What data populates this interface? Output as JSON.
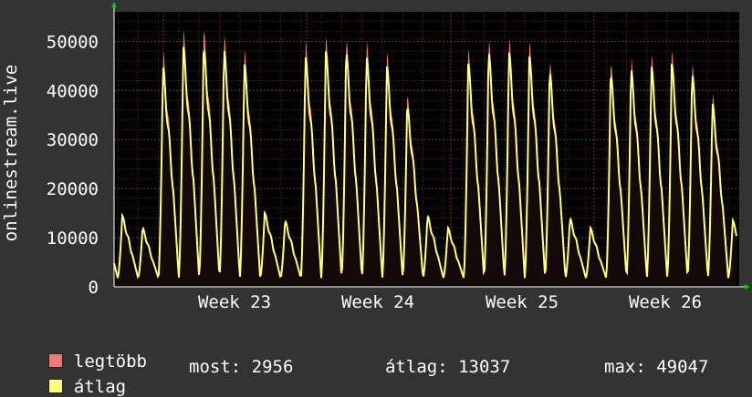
{
  "chart_data": {
    "type": "area",
    "ylabel": "onlinestream.live",
    "ylim": [
      0,
      56000
    ],
    "yticks": [
      0,
      10000,
      20000,
      30000,
      40000,
      50000
    ],
    "x_tick_labels": [
      "Week 23",
      "Week 24",
      "Week 25",
      "Week 26"
    ],
    "grid": true,
    "series": [
      {
        "name": "legtöbb",
        "color": "#f07878",
        "daily_peaks": [
          15000,
          12500,
          48500,
          52500,
          53000,
          52000,
          48500,
          15500,
          14000,
          50500,
          51000,
          51000,
          50500,
          48000,
          39500,
          15000,
          12500,
          48500,
          51000,
          51000,
          50000,
          46500,
          14500,
          12500,
          46000,
          47000,
          47500,
          48000,
          46000,
          39500,
          14000,
          11000
        ]
      },
      {
        "name": "átlag",
        "color": "#ffff80",
        "daily_peaks": [
          14500,
          12000,
          45000,
          49000,
          49000,
          48500,
          45500,
          15000,
          13500,
          47000,
          48000,
          48000,
          47000,
          45000,
          37000,
          14500,
          12000,
          45500,
          48000,
          48000,
          47000,
          44000,
          14000,
          12000,
          43500,
          44500,
          45000,
          45500,
          43500,
          37500,
          13500,
          10500
        ]
      }
    ]
  },
  "legend": {
    "items": [
      {
        "label": "legtöbb",
        "color": "#f07878"
      },
      {
        "label": "átlag",
        "color": "#ffff80"
      }
    ],
    "stats": {
      "most": "most: 2956",
      "atlag": "átlag: 13037",
      "max": "max: 49047"
    }
  }
}
